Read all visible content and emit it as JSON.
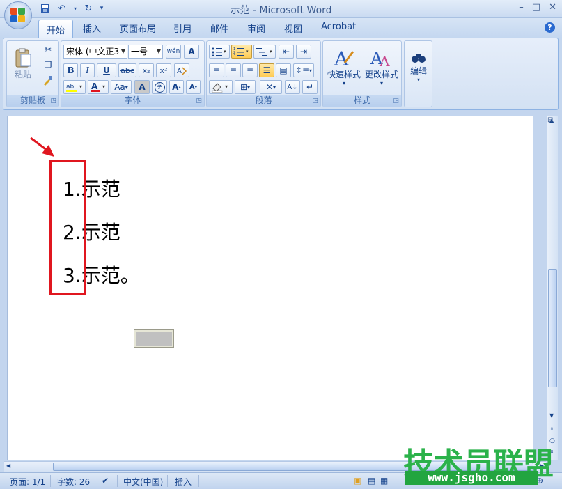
{
  "window": {
    "title": "示范 - Microsoft Word",
    "minimize": "–",
    "maximize": "□",
    "close": "✕"
  },
  "tabs": [
    {
      "label": "开始"
    },
    {
      "label": "插入"
    },
    {
      "label": "页面布局"
    },
    {
      "label": "引用"
    },
    {
      "label": "邮件"
    },
    {
      "label": "审阅"
    },
    {
      "label": "视图"
    },
    {
      "label": "Acrobat"
    }
  ],
  "ribbon": {
    "clipboard": {
      "label": "剪贴板",
      "paste_label": "粘贴"
    },
    "font": {
      "label": "字体",
      "font_name": "宋体 (中文正3",
      "font_size": "一号",
      "bold": "B",
      "italic": "I",
      "underline": "U",
      "strike": "abc",
      "subscript": "x₂",
      "superscript": "x²",
      "case": "Aa",
      "char_border": "A",
      "grow": "A",
      "shrink": "A",
      "wen": "wén",
      "char_shading": "A",
      "phonetic": "字"
    },
    "paragraph": {
      "label": "段落"
    },
    "styles": {
      "label": "样式",
      "quick_styles": "快速样式",
      "change_styles": "更改样式"
    },
    "editing": {
      "label": "编辑"
    }
  },
  "document": {
    "list": [
      {
        "num": "1.",
        "text": "示范"
      },
      {
        "num": "2.",
        "text": "示范"
      },
      {
        "num": "3.",
        "text": "示范。"
      }
    ]
  },
  "status": {
    "page": "页面: 1/1",
    "words": "字数: 26",
    "language": "中文(中国)",
    "mode": "插入"
  },
  "watermark": {
    "name": "技术员联盟",
    "url": "www.jsgho.com"
  },
  "colors": {
    "highlight_box": "#e0161f",
    "arrow": "#e0161f",
    "watermark": "#2bb24a"
  }
}
